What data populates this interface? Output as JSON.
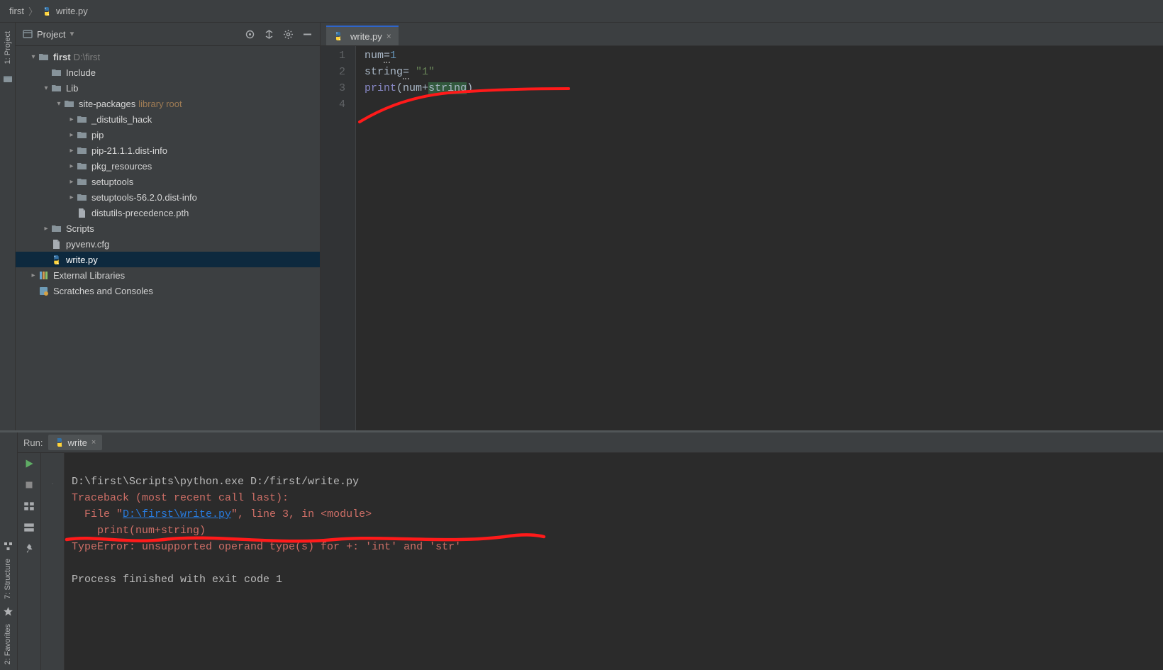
{
  "breadcrumb": {
    "root": "first",
    "file": "write.py"
  },
  "left_tool": {
    "project_label": "1: Project"
  },
  "project_panel": {
    "title": "Project",
    "tree": {
      "root": {
        "name": "first",
        "path": "D:\\first"
      },
      "include": "Include",
      "lib": "Lib",
      "site_packages": "site-packages",
      "library_root_tag": "library root",
      "items": [
        "_distutils_hack",
        "pip",
        "pip-21.1.1.dist-info",
        "pkg_resources",
        "setuptools",
        "setuptools-56.2.0.dist-info"
      ],
      "file_pth": "distutils-precedence.pth",
      "scripts": "Scripts",
      "pyvenv": "pyvenv.cfg",
      "write_py": "write.py",
      "ext_lib": "External Libraries",
      "scratches": "Scratches and Consoles"
    }
  },
  "editor": {
    "tab": "write.py",
    "gutter": [
      "1",
      "2",
      "3",
      "4"
    ],
    "code": {
      "l1_left": "num",
      "l1_op": "=",
      "l1_right": "1",
      "l2_left": "string",
      "l2_op": "=",
      "l2_right": " \"1\"",
      "l3_fn": "print",
      "l3_open": "(",
      "l3_a": "num",
      "l3_plus": "+",
      "l3_b": "string",
      "l3_close": ")"
    }
  },
  "run": {
    "title": "Run:",
    "tab_label": "write",
    "lines": {
      "cmd": "D:\\first\\Scripts\\python.exe D:/first/write.py",
      "tb": "Traceback (most recent call last):",
      "file_pre": "  File \"",
      "file_link": "D:\\first\\write.py",
      "file_post": "\", line 3, in <module>",
      "code": "    print(num+string)",
      "err": "TypeError: unsupported operand type(s) for +: 'int' and 'str'",
      "exit": "Process finished with exit code 1"
    }
  },
  "left_bottom": {
    "structure": "7: Structure",
    "favorites": "2: Favorites"
  }
}
